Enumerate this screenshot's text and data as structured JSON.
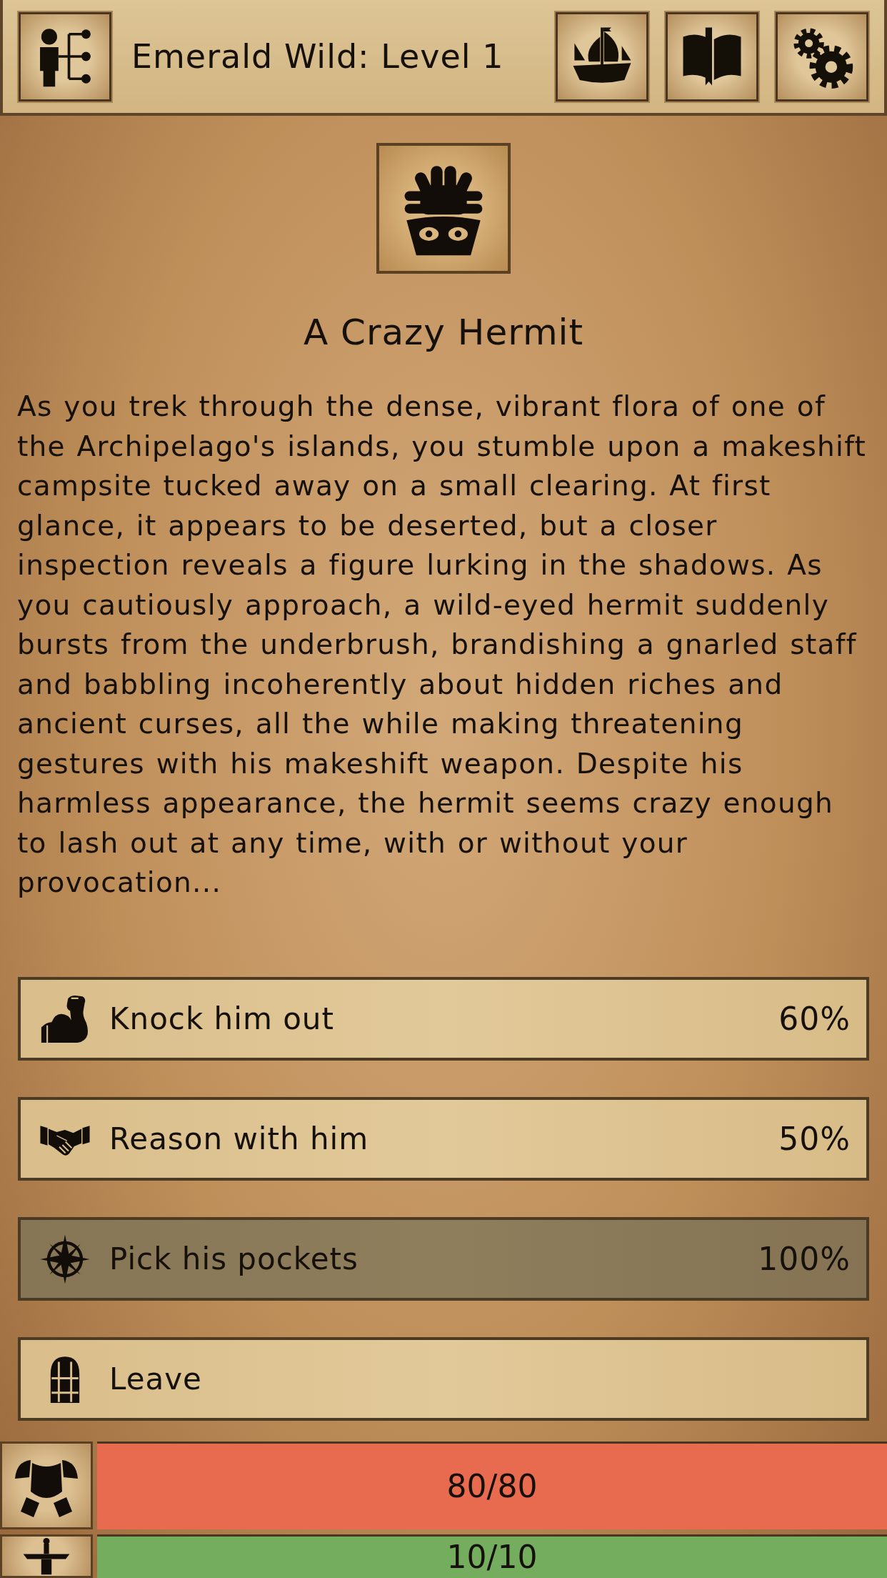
{
  "header": {
    "title": "Emerald Wild: Level 1"
  },
  "event": {
    "title": "A Crazy Hermit",
    "description": "As you trek through the dense, vibrant flora of one of the Archipelago's islands, you stumble upon a makeshift campsite tucked away on a small clearing. At first glance, it appears to be deserted, but a closer inspection reveals a figure lurking in the shadows. As you cautiously approach, a wild-eyed hermit suddenly bursts from the underbrush, brandishing a gnarled staff and babbling incoherently about hidden riches and ancient curses, all the while making threatening gestures with his makeshift weapon. Despite his harmless appearance, the hermit seems crazy enough to lash out at any time, with or without your provocation..."
  },
  "choices": [
    {
      "label": "Knock him out",
      "chance": "60%",
      "selected": false
    },
    {
      "label": "Reason with him",
      "chance": "50%",
      "selected": false
    },
    {
      "label": "Pick his pockets",
      "chance": "100%",
      "selected": true
    },
    {
      "label": "Leave",
      "selected": false
    }
  ],
  "stats": [
    {
      "reading": "80/80",
      "level": 1,
      "color": "#e86a4f"
    },
    {
      "reading": "10/10",
      "level": 1,
      "color": "#74ad5e"
    }
  ]
}
